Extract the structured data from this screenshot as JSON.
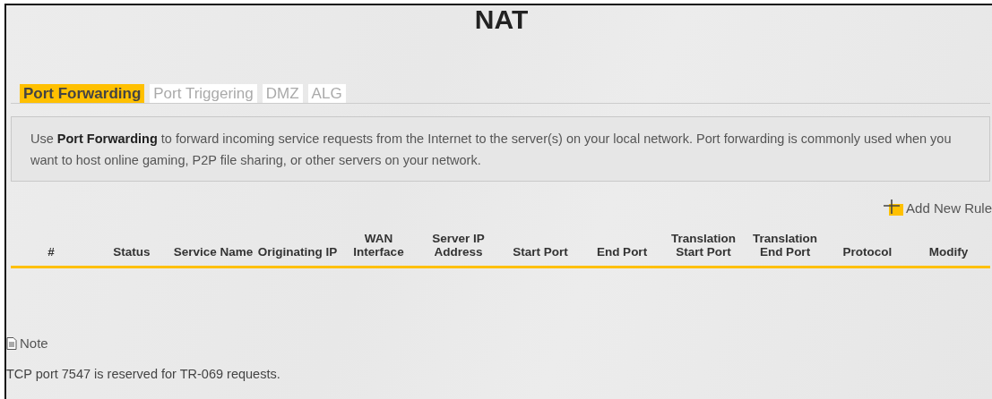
{
  "page_title": "NAT",
  "tabs": [
    {
      "label": "Port Forwarding",
      "selected": true
    },
    {
      "label": "Port Triggering",
      "selected": false
    },
    {
      "label": "DMZ",
      "selected": false
    },
    {
      "label": "ALG",
      "selected": false
    }
  ],
  "description": "Use **Port Forwarding** to forward incoming service requests from the Internet to the server(s) on your local network. Port forwarding is commonly used when you want to host online gaming, P2P file sharing, or other servers on your network.",
  "add_button": {
    "label": "Add New Rule"
  },
  "table": {
    "columns": [
      "#",
      "Status",
      "Service Name",
      "Originating IP",
      "WAN Interface",
      "Server IP Address",
      "Start Port",
      "End Port",
      "Translation Start Port",
      "Translation End Port",
      "Protocol",
      "Modify"
    ]
  },
  "note": {
    "title": "Note",
    "text": "TCP port 7547 is reserved for TR-069 requests."
  }
}
